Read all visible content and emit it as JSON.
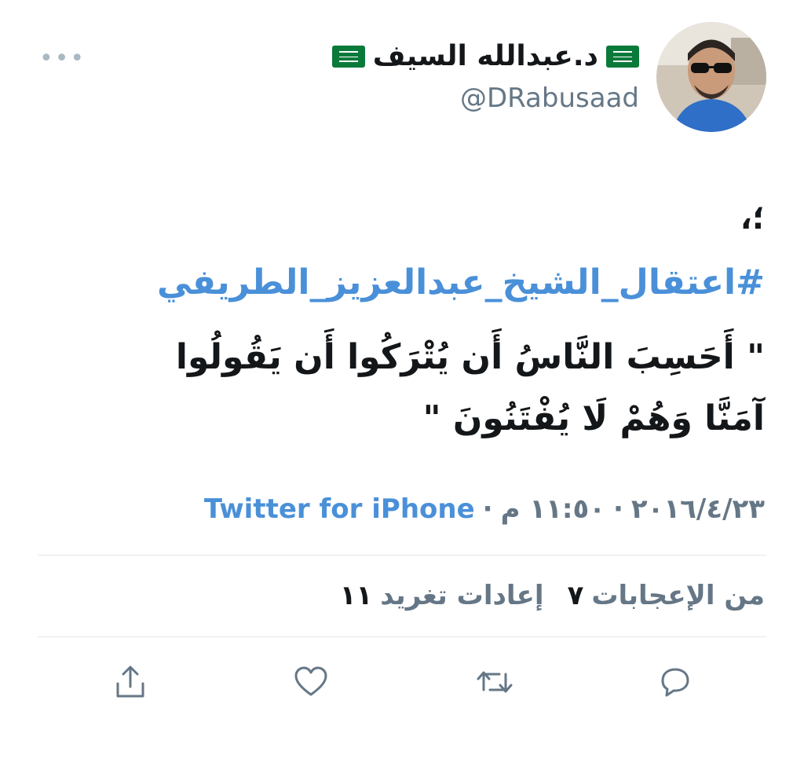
{
  "user": {
    "display_name": "د.عبدالله السيف",
    "handle": "@DRabusaad",
    "flag_icon": "saudi-flag-icon"
  },
  "menu": {
    "more_label": "•••"
  },
  "tweet": {
    "lead_punctuation": "؛،",
    "hashtag": "#اعتقال_الشيخ_عبدالعزيز_الطريفي",
    "quote": "\" أَحَسِبَ النَّاسُ أَن يُتْرَكُوا أَن يَقُولُوا آمَنَّا وَهُمْ لَا يُفْتَنُونَ \""
  },
  "meta": {
    "date": "٢٠١٦/٤/٢٣",
    "separator": "·",
    "time": "١١:٥٠ م",
    "source": "Twitter for iPhone"
  },
  "stats": {
    "retweets_count": "١١",
    "retweets_label": "إعادات تغريد",
    "likes_count": "٧",
    "likes_label": "من الإعجابات"
  },
  "actions": {
    "reply_icon": "reply-icon",
    "retweet_icon": "retweet-icon",
    "like_icon": "heart-icon",
    "share_icon": "share-icon"
  },
  "colors": {
    "link": "#4a90d9",
    "muted": "#657786",
    "text": "#14171a",
    "divider": "#e1e8ed",
    "flag_green": "#0a7a3b"
  }
}
